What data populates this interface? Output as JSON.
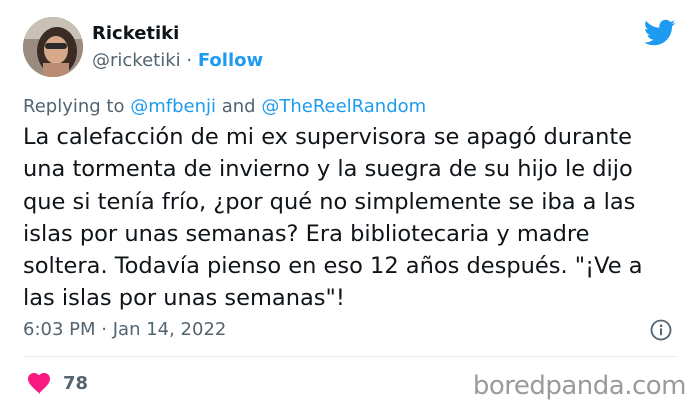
{
  "tweet": {
    "author": {
      "display_name": "Ricketiki",
      "handle": "@ricketiki",
      "separator": "·",
      "follow_label": "Follow"
    },
    "replying": {
      "prefix": "Replying to",
      "mention1": "@mfbenji",
      "conjunction": "and",
      "mention2": "@TheReelRandom"
    },
    "text": "La calefacción de mi ex supervisora se apagó durante\nuna tormenta de invierno y la suegra de su hijo le dijo\nque si tenía frío, ¿por qué no simplemente se iba a las\nislas por unas semanas? Era bibliotecaria y madre\nsoltera. Todavía pienso en eso 12 años después. \"¡Ve a\nlas islas por unas semanas\"!",
    "time": "6:03 PM",
    "date_separator": "·",
    "date": "Jan 14, 2022",
    "likes": "78"
  },
  "watermark": "boredpanda.com",
  "colors": {
    "accent": "#1d9bf0",
    "like": "#f91880",
    "muted": "#536471"
  },
  "icons": [
    "twitter-bird-icon",
    "info-icon",
    "heart-icon"
  ]
}
